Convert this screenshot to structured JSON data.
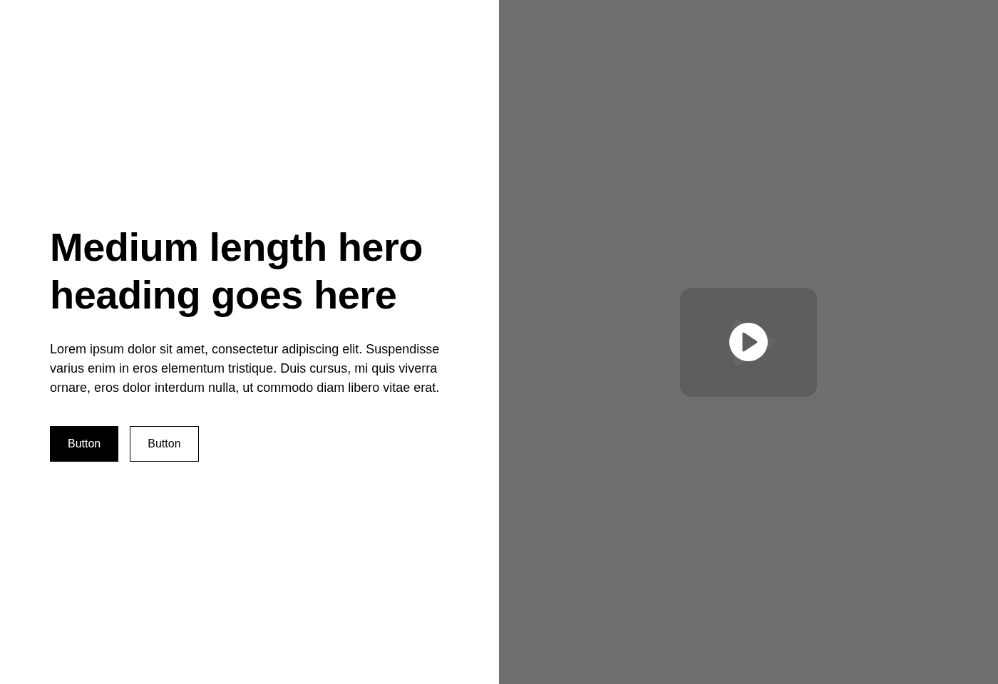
{
  "hero": {
    "heading": "Medium length hero heading goes here",
    "description": "Lorem ipsum dolor sit amet, consectetur adipiscing elit. Suspendisse varius enim in eros elementum tristique. Duis cursus, mi quis viverra ornare, eros dolor interdum nulla, ut commodo diam libero vitae erat.",
    "buttons": [
      {
        "label": "Button",
        "kind": "primary"
      },
      {
        "label": "Button",
        "kind": "secondary"
      }
    ]
  }
}
